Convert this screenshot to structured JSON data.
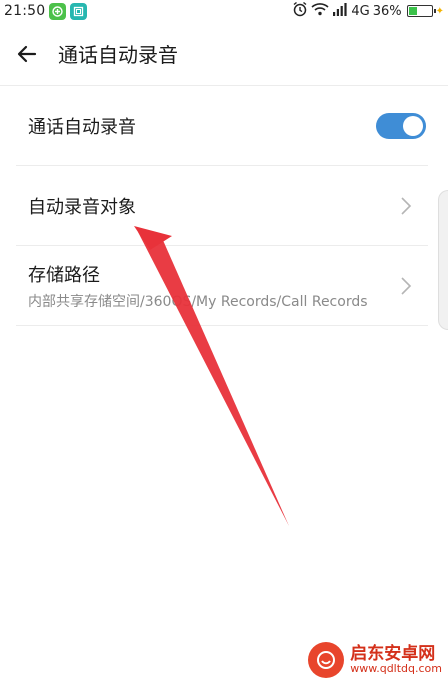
{
  "status_bar": {
    "time": "21:50",
    "network": "4G",
    "battery_percent": "36%",
    "battery_level": 0.36,
    "icons": [
      "green-app-icon",
      "teal-app-icon",
      "alarm-icon",
      "wifi-icon",
      "signal-icon",
      "battery-icon"
    ]
  },
  "header": {
    "title": "通话自动录音",
    "back_icon": "back-arrow-icon"
  },
  "settings": {
    "auto_record": {
      "label": "通话自动录音",
      "enabled": true
    },
    "record_targets": {
      "label": "自动录音对象"
    },
    "storage_path": {
      "label": "存储路径",
      "value": "内部共享存储空间/360OS/My Records/Call Records"
    }
  },
  "colors": {
    "accent": "#3f8dd6",
    "annotation_arrow": "#e8323a",
    "watermark": "#d4301a"
  },
  "watermark": {
    "title": "启东安卓网",
    "url": "www.qdltdq.com"
  }
}
